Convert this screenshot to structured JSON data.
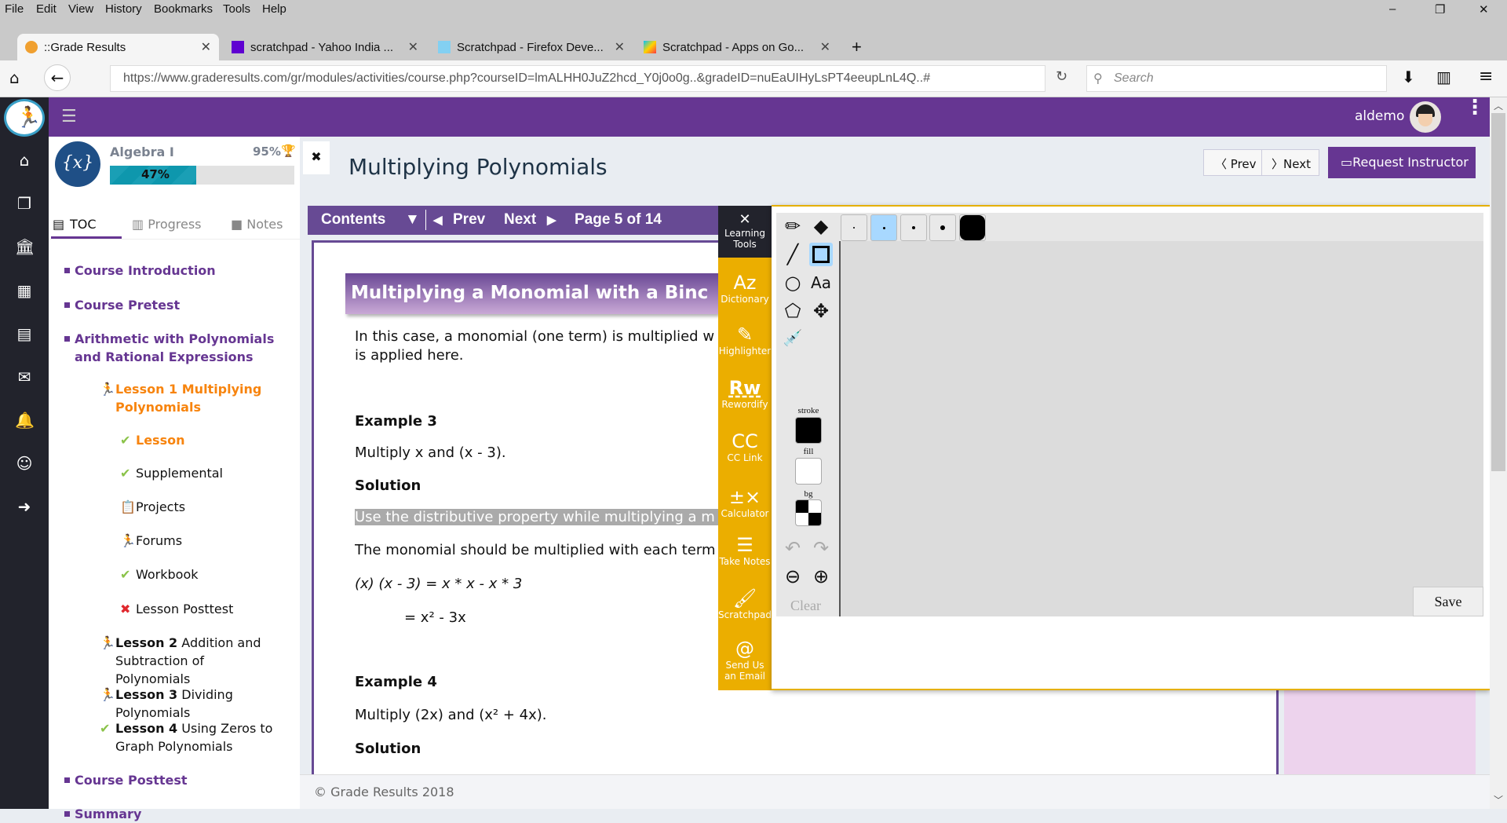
{
  "browser": {
    "menu": [
      "File",
      "Edit",
      "View",
      "History",
      "Bookmarks",
      "Tools",
      "Help"
    ],
    "tabs": [
      {
        "title": "::Grade Results"
      },
      {
        "title": "scratchpad - Yahoo India ..."
      },
      {
        "title": "Scratchpad - Firefox Deve..."
      },
      {
        "title": "Scratchpad - Apps on Go..."
      }
    ],
    "url": "https://www.graderesults.com/gr/modules/activities/course.php?courseID=lmALHH0JuZ2hcd_Y0j0o0g..&gradeID=nuEaUIHyLsPT4eeupLnL4Q..#",
    "search_placeholder": "Search"
  },
  "header": {
    "username": "aldemo"
  },
  "course": {
    "name": "Algebra I",
    "score": "95%",
    "progress_label": "47%",
    "progress": 47,
    "tabs": [
      "TOC",
      "Progress",
      "Notes"
    ],
    "toc": [
      {
        "label": "Course Introduction",
        "type": "section"
      },
      {
        "label": "Course Pretest",
        "type": "section"
      },
      {
        "label": "Arithmetic with Polynomials and Rational Expressions",
        "type": "section"
      },
      {
        "bold": "Lesson 1 Multiplying Polynomials",
        "rest": "",
        "type": "lesson",
        "icon": "runner",
        "active": true
      },
      {
        "label": "Lesson",
        "type": "sub",
        "icon": "check",
        "active": true
      },
      {
        "label": "Supplemental",
        "type": "sub",
        "icon": "check"
      },
      {
        "label": "Projects",
        "type": "sub",
        "icon": "project"
      },
      {
        "label": "Forums",
        "type": "sub",
        "icon": "runner"
      },
      {
        "label": "Workbook",
        "type": "sub",
        "icon": "check"
      },
      {
        "label": "Lesson Posttest",
        "type": "sub",
        "icon": "cross"
      },
      {
        "bold": "Lesson 2",
        "rest": " Addition and Subtraction of Polynomials",
        "type": "lesson",
        "icon": "runner"
      },
      {
        "bold": "Lesson 3",
        "rest": " Dividing Polynomials",
        "type": "lesson",
        "icon": "runner"
      },
      {
        "bold": "Lesson 4",
        "rest": " Using Zeros to Graph Polynomials",
        "type": "lesson",
        "icon": "check"
      },
      {
        "label": "Course Posttest",
        "type": "section"
      },
      {
        "label": "Summary",
        "type": "section"
      }
    ]
  },
  "page": {
    "title": "Multiplying Polynomials",
    "prev": "Prev",
    "next": "Next",
    "request": "Request Instructor",
    "contents": "Contents",
    "bar_prev": "Prev",
    "bar_next": "Next",
    "page_info": "Page 5 of 14",
    "heading": "Multiplying a Monomial with a Binc",
    "intro1": "In this case, a monomial (one term) is multiplied w",
    "intro2": "is applied here.",
    "ex3": "Example 3",
    "ex3_q": "Multiply x and (x - 3).",
    "sol": "Solution",
    "highlight": "Use the distributive property while multiplying a m",
    "mono": "The monomial should be multiplied with each term",
    "eq1": "(x) (x - 3) = x * x - x * 3",
    "eq2": "= x² - 3x",
    "ex4": "Example 4",
    "ex4_q": "Multiply (2x) and (x² + 4x).",
    "sol2": "Solution",
    "footer": "© Grade Results 2018"
  },
  "tools": {
    "header": "Learning Tools",
    "items": [
      "Dictionary",
      "Highlighter",
      "Rewordify",
      "CC Link",
      "Calculator",
      "Take Notes",
      "Scratchpad",
      "Send Us an Email"
    ]
  },
  "scratchpad": {
    "stroke": "stroke",
    "fill": "fill",
    "bg": "bg",
    "clear": "Clear",
    "save": "Save",
    "font_tool": "Aa",
    "selected_size": 2,
    "stroke_color": "#000000",
    "fill_color": "#ffffff"
  }
}
